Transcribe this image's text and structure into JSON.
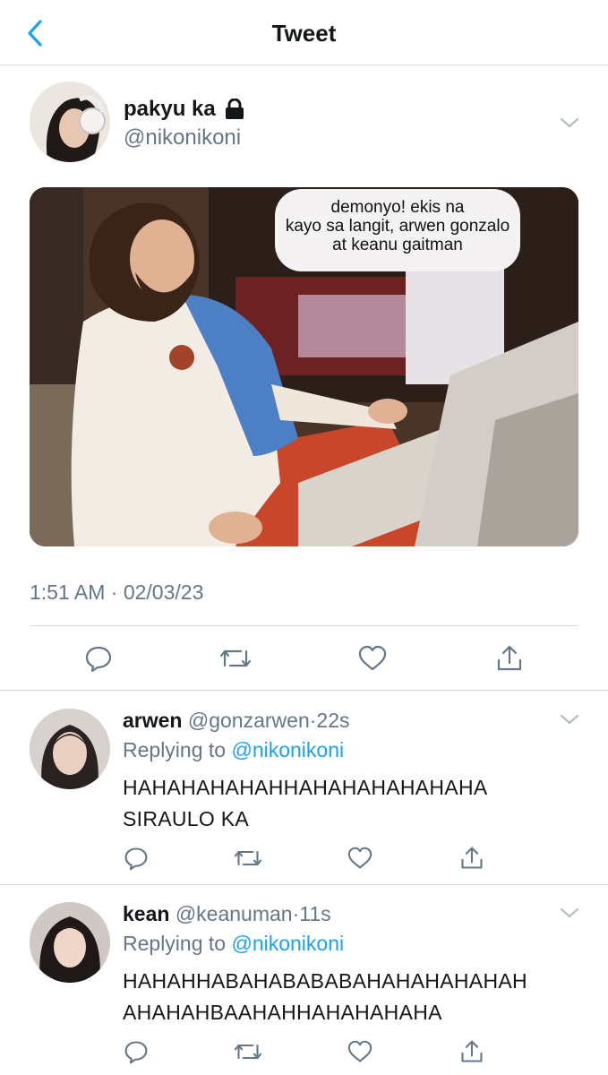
{
  "nav": {
    "title": "Tweet"
  },
  "tweet": {
    "display_name": "pakyu ka",
    "handle": "@nikonikoni",
    "image_caption": "demonyo! ekis na\nkayo sa langit, arwen gonzalo\nat keanu gaitman",
    "caption_lines": [
      "demonyo! ekis na",
      "kayo sa langit, arwen gonzalo",
      "at keanu gaitman"
    ],
    "timestamp": "1:51 AM · 02/03/23"
  },
  "replies": [
    {
      "display_name": "arwen",
      "handle": "@gonzarwen",
      "separator": "·",
      "time": "22s",
      "replying_prefix": "Replying to",
      "replying_to": "@nikonikoni",
      "text_lines": [
        "HAHAHAHAHAHHAHAHAHAHAHAHA",
        "SIRAULO KA"
      ]
    },
    {
      "display_name": "kean",
      "handle": "@keanuman",
      "separator": "·",
      "time": "11s",
      "replying_prefix": "Replying to",
      "replying_to": "@nikonikoni",
      "text_lines": [
        "HAHAHHABAHABABABAHAHAHAHAHAH",
        "AHAHAHBAAHAHHAHAHAHAHA"
      ]
    }
  ],
  "colors": {
    "accent": "#1da1f2",
    "secondary_text": "#657786",
    "divider": "#d8dde1",
    "icon": "#657786"
  },
  "icons": [
    "back-arrow-icon",
    "lock-icon",
    "chevron-down-icon",
    "reply-icon",
    "retweet-icon",
    "like-icon",
    "share-icon"
  ]
}
